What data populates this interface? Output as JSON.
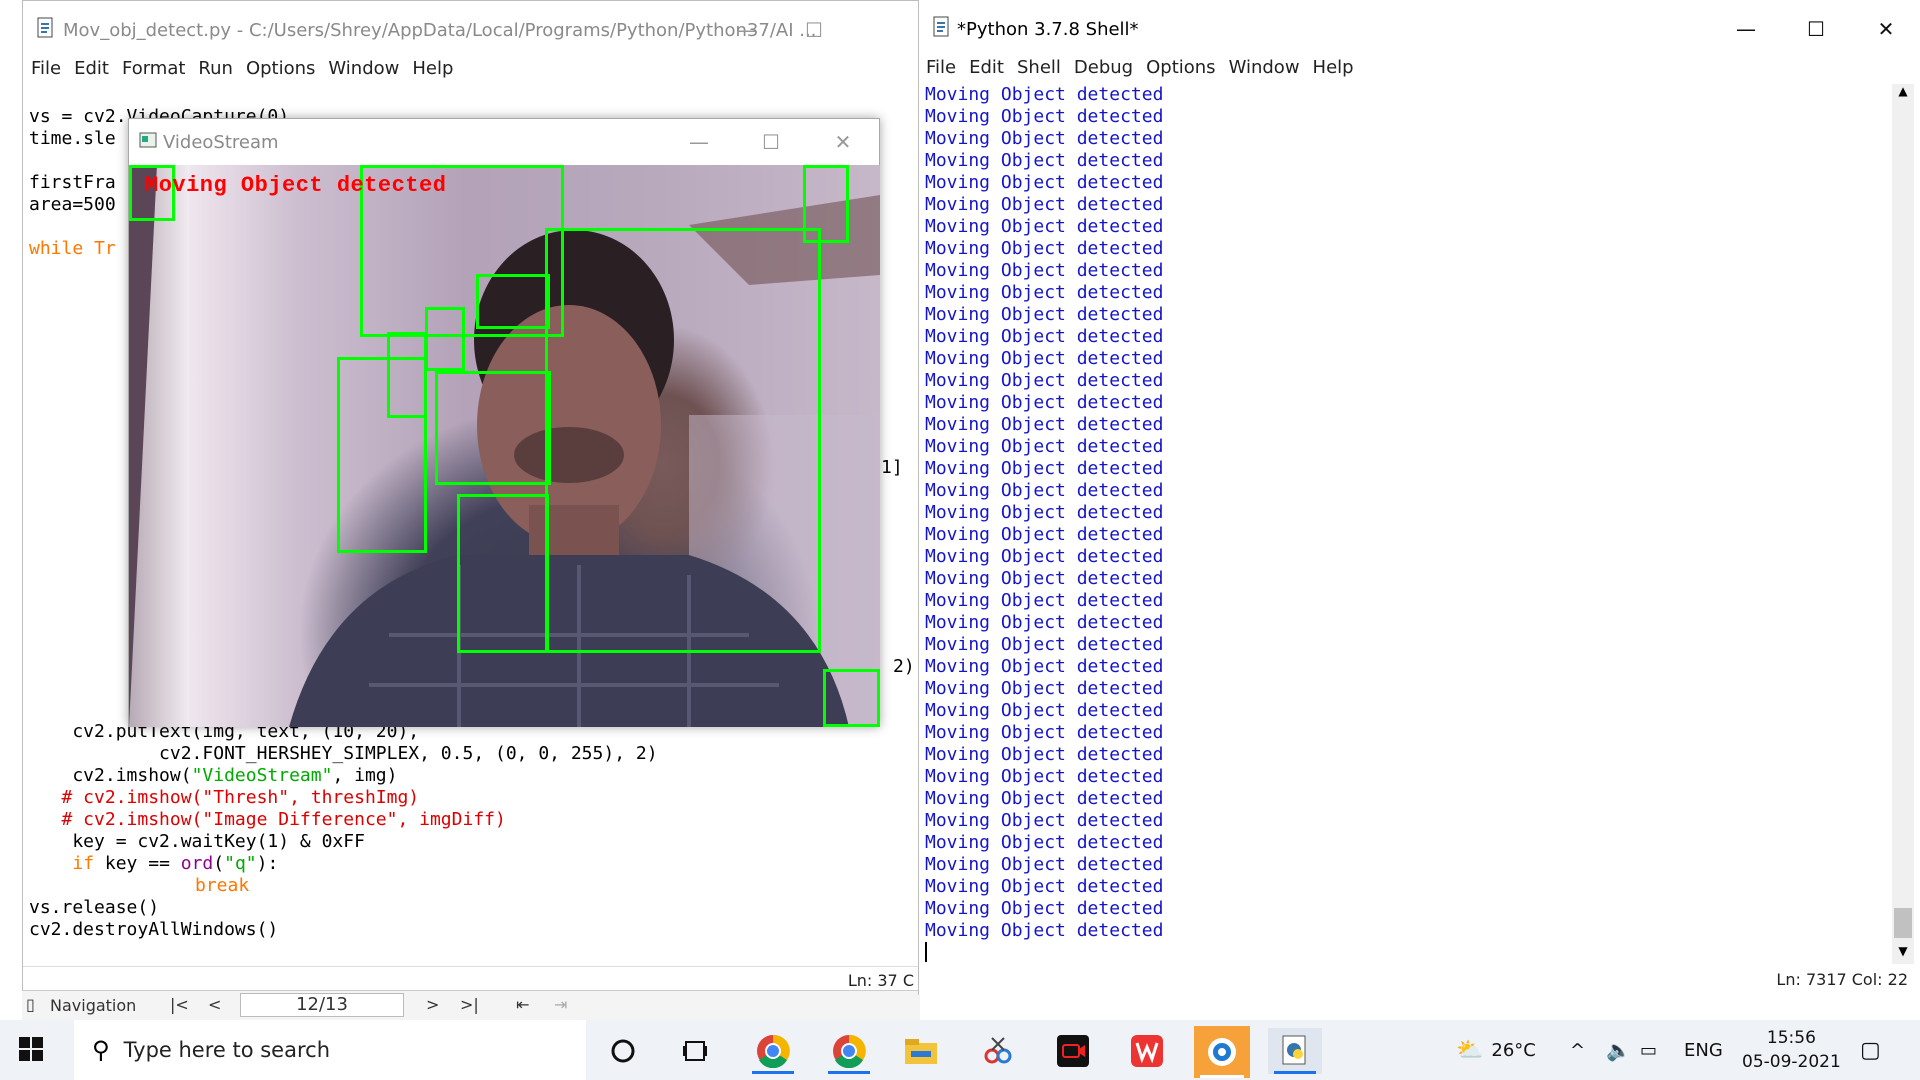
{
  "editor": {
    "title": "Mov_obj_detect.py - C:/Users/Shrey/AppData/Local/Programs/Python/Python37/AI ...",
    "menu": [
      "File",
      "Edit",
      "Format",
      "Run",
      "Options",
      "Window",
      "Help"
    ],
    "code_top": {
      "line1": "vs = cv2.VideoCapture(0)",
      "line2": "time.sle",
      "line3": "firstFra",
      "line4": "area=500",
      "line5_kw": "while",
      "line5_rest": " Tr"
    },
    "partial_right_1": "1]",
    "partial_right_2": "2)",
    "code_bottom": {
      "l1": "    cv2.putText(img, text, (10, 20),",
      "l2": "            cv2.FONT_HERSHEY_SIMPLEX, 0.5, (0, 0, 255), 2)",
      "l3_pre": "    cv2.imshow(",
      "l3_str": "\"VideoStream\"",
      "l3_post": ", img)",
      "l4": "   # cv2.imshow(\"Thresh\", threshImg)",
      "l5": "   # cv2.imshow(\"Image Difference\", imgDiff)",
      "l6": "    key = cv2.waitKey(1) & 0xFF",
      "l7_kw": "if",
      "l7_mid": " key == ",
      "l7_bi": "ord",
      "l7_pre": "(",
      "l7_str": "\"q\"",
      "l7_end": "):",
      "l8": "break",
      "l9": "vs.release()",
      "l10": "cv2.destroyAllWindows()"
    },
    "status": "Ln: 37  C"
  },
  "pdf_nav": {
    "label": "Navigation",
    "page": "12/13"
  },
  "video": {
    "title": "VideoStream",
    "overlay": "Moving Object detected"
  },
  "shell": {
    "title": "*Python 3.7.8 Shell*",
    "menu": [
      "File",
      "Edit",
      "Shell",
      "Debug",
      "Options",
      "Window",
      "Help"
    ],
    "line_text": "Moving Object detected",
    "line_count": 39,
    "status": "Ln: 7317  Col: 22"
  },
  "taskbar": {
    "search_placeholder": "Type here to search",
    "weather": "26°C",
    "lang": "ENG",
    "time": "15:56",
    "date": "05-09-2021"
  },
  "colors": {
    "box": "#00ff00",
    "overlay_text": "#ff0000",
    "shell_text": "#1515c8"
  }
}
